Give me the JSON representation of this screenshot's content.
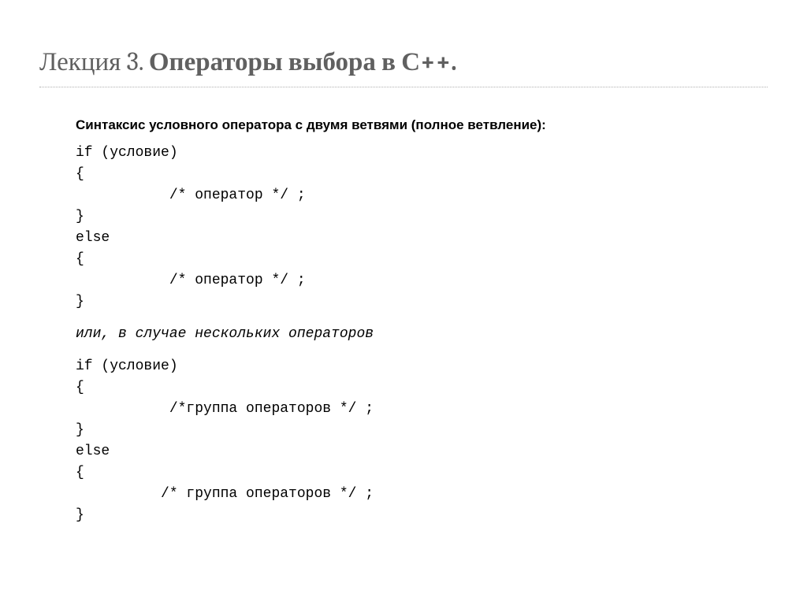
{
  "title": {
    "prefix": "Лекция 3. ",
    "main": "Операторы выбора",
    "suffix": " в С++."
  },
  "subtitle": "Синтаксис условного оператора с двумя ветвями (полное ветвление):",
  "code1": "if (условие)\n{\n           /* оператор */ ;\n}\nelse\n{\n           /* оператор */ ;\n}",
  "note": "или, в случае нескольких операторов",
  "code2": "if (условие)\n{\n           /*группа операторов */ ;\n}\nelse\n{\n          /* группа операторов */ ;\n}"
}
